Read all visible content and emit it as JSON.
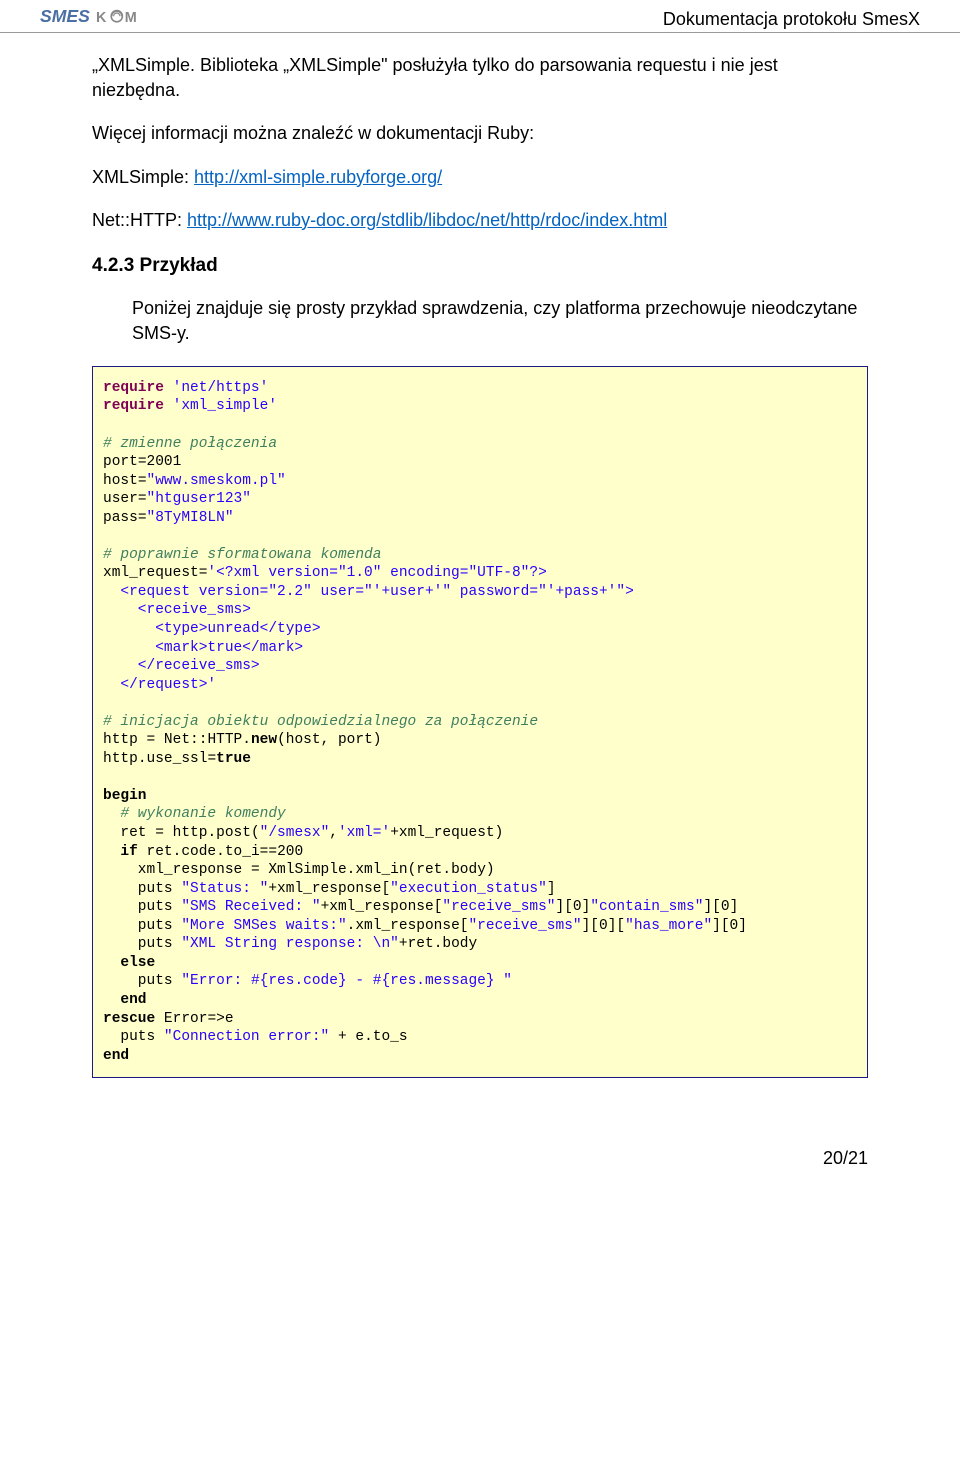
{
  "header": {
    "logo_brand": "SMES",
    "logo_sub": "KOM",
    "doc_title": "Dokumentacja protokołu SmesX"
  },
  "intro": {
    "p1a": "„XMLSimple. Biblioteka „XMLSimple\" posłużyła tylko do parsowania requestu i nie jest niezbędna.",
    "p2": "Więcej informacji można znaleźć w dokumentacji Ruby:",
    "p3_label": "XMLSimple: ",
    "p3_link": "http://xml-simple.rubyforge.org/",
    "p4_label": "Net::HTTP: ",
    "p4_link": "http://www.ruby-doc.org/stdlib/libdoc/net/http/rdoc/index.html"
  },
  "section": {
    "heading": "4.2.3 Przykład",
    "p1": "Poniżej znajduje się prosty przykład sprawdzenia, czy platforma przechowuje nieodczytane SMS-y."
  },
  "code": {
    "l01a": "require",
    "l01b": " 'net/https'",
    "l02a": "require",
    "l02b": " 'xml_simple'",
    "l03": "",
    "l04": "# zmienne połączenia",
    "l05a": "port",
    "l05b": "=",
    "l05c": "2001",
    "l06a": "host",
    "l06b": "=",
    "l06c": "\"www.smeskom.pl\"",
    "l07a": "user",
    "l07b": "=",
    "l07c": "\"htguser123\"",
    "l08a": "pass",
    "l08b": "=",
    "l08c": "\"8TyMI8LN\"",
    "l09": "",
    "l10": "# poprawnie sformatowana komenda",
    "l11a": "xml_request",
    "l11b": "=",
    "l11c": "'<?xml version=\"1.0\" encoding=\"UTF-8\"?>",
    "l12": "  <request version=\"2.2\" user=\"'+user+'\" password=\"'+pass+'\">",
    "l13": "    <receive_sms>",
    "l14": "      <type>unread</type>",
    "l15": "      <mark>true</mark>",
    "l16": "    </receive_sms>",
    "l17": "  </request>'",
    "l18": "",
    "l19": "# inicjacja obiektu odpowiedzialnego za połączenie",
    "l20a": "http ",
    "l20b": "=",
    "l20c": " Net",
    "l20d": "::",
    "l20e": "HTTP",
    "l20f": ".",
    "l20g": "new",
    "l20h": "(host, port)",
    "l21a": "http",
    "l21b": ".",
    "l21c": "use_ssl",
    "l21d": "=",
    "l21e": "true",
    "l22": "",
    "l23": "begin",
    "l24": "  # wykonanie komendy",
    "l25a": "  ret ",
    "l25b": "=",
    "l25c": " http",
    "l25d": ".",
    "l25e": "post",
    "l25f": "(",
    "l25g": "\"/smesx\"",
    "l25h": ",",
    "l25i": "'xml='",
    "l25j": "+xml_request",
    "l25k": ")",
    "l26a": "  if",
    "l26b": " ret",
    "l26c": ".",
    "l26d": "code",
    "l26e": ".",
    "l26f": "to_i",
    "l26g": "==",
    "l26h": "200",
    "l27a": "    xml_response ",
    "l27b": "=",
    "l27c": " XmlSimple",
    "l27d": ".",
    "l27e": "xml_in",
    "l27f": "(ret",
    "l27g": ".",
    "l27h": "body",
    "l27i": ")",
    "l28a": "    puts ",
    "l28b": "\"Status: \"",
    "l28c": "+xml_response",
    "l28d": "[",
    "l28e": "\"execution_status\"",
    "l28f": "]",
    "l29a": "    puts ",
    "l29b": "\"SMS Received: \"",
    "l29c": "+xml_response",
    "l29d": "[",
    "l29e": "\"receive_sms\"",
    "l29f": "][",
    "l29g": "0",
    "l29h": "]",
    "l29i": "\"contain_sms\"",
    "l29j": "][",
    "l29k": "0",
    "l29l": "]",
    "l30a": "    puts ",
    "l30b": "\"More SMSes waits:\"",
    "l30c": ".xml_response",
    "l30d": "[",
    "l30e": "\"receive_sms\"",
    "l30f": "][",
    "l30g": "0",
    "l30h": "][",
    "l30i": "\"has_more\"",
    "l30j": "][",
    "l30k": "0",
    "l30l": "]",
    "l31a": "    puts ",
    "l31b": "\"XML String response: \\n\"",
    "l31c": "+ret",
    "l31d": ".",
    "l31e": "body",
    "l32": "  else",
    "l33a": "    puts ",
    "l33b": "\"Error: #{res.code} - #{res.message} \"",
    "l34": "  end",
    "l35a": "rescue",
    "l35b": " Error",
    "l35c": "=>",
    "l35d": "e",
    "l36a": "  puts ",
    "l36b": "\"Connection error:\"",
    "l36c": " + e",
    "l36d": ".",
    "l36e": "to_s",
    "l37": "end"
  },
  "footer": {
    "page": "20/21"
  }
}
